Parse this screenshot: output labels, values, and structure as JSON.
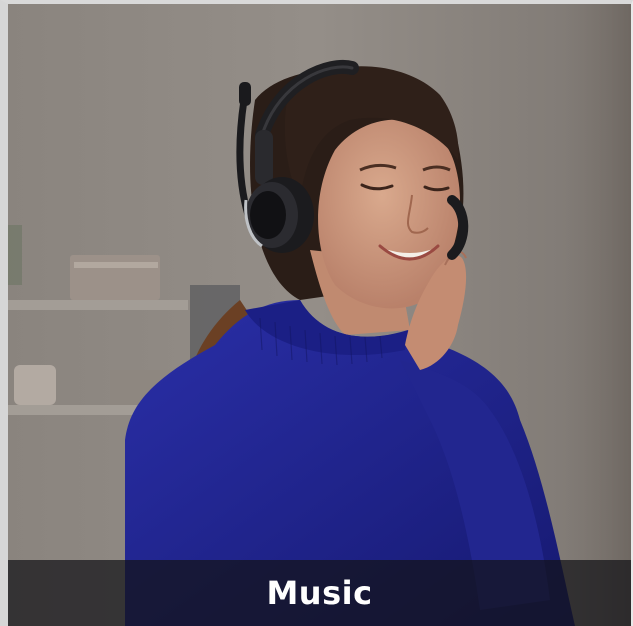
{
  "card": {
    "caption": "Music"
  },
  "colors": {
    "wall": "#8f8983",
    "sweater": "#1c1f8c",
    "caption_bar": "#141418",
    "caption_text": "#ffffff"
  },
  "image": {
    "subject": "woman-wearing-headset-icon"
  }
}
